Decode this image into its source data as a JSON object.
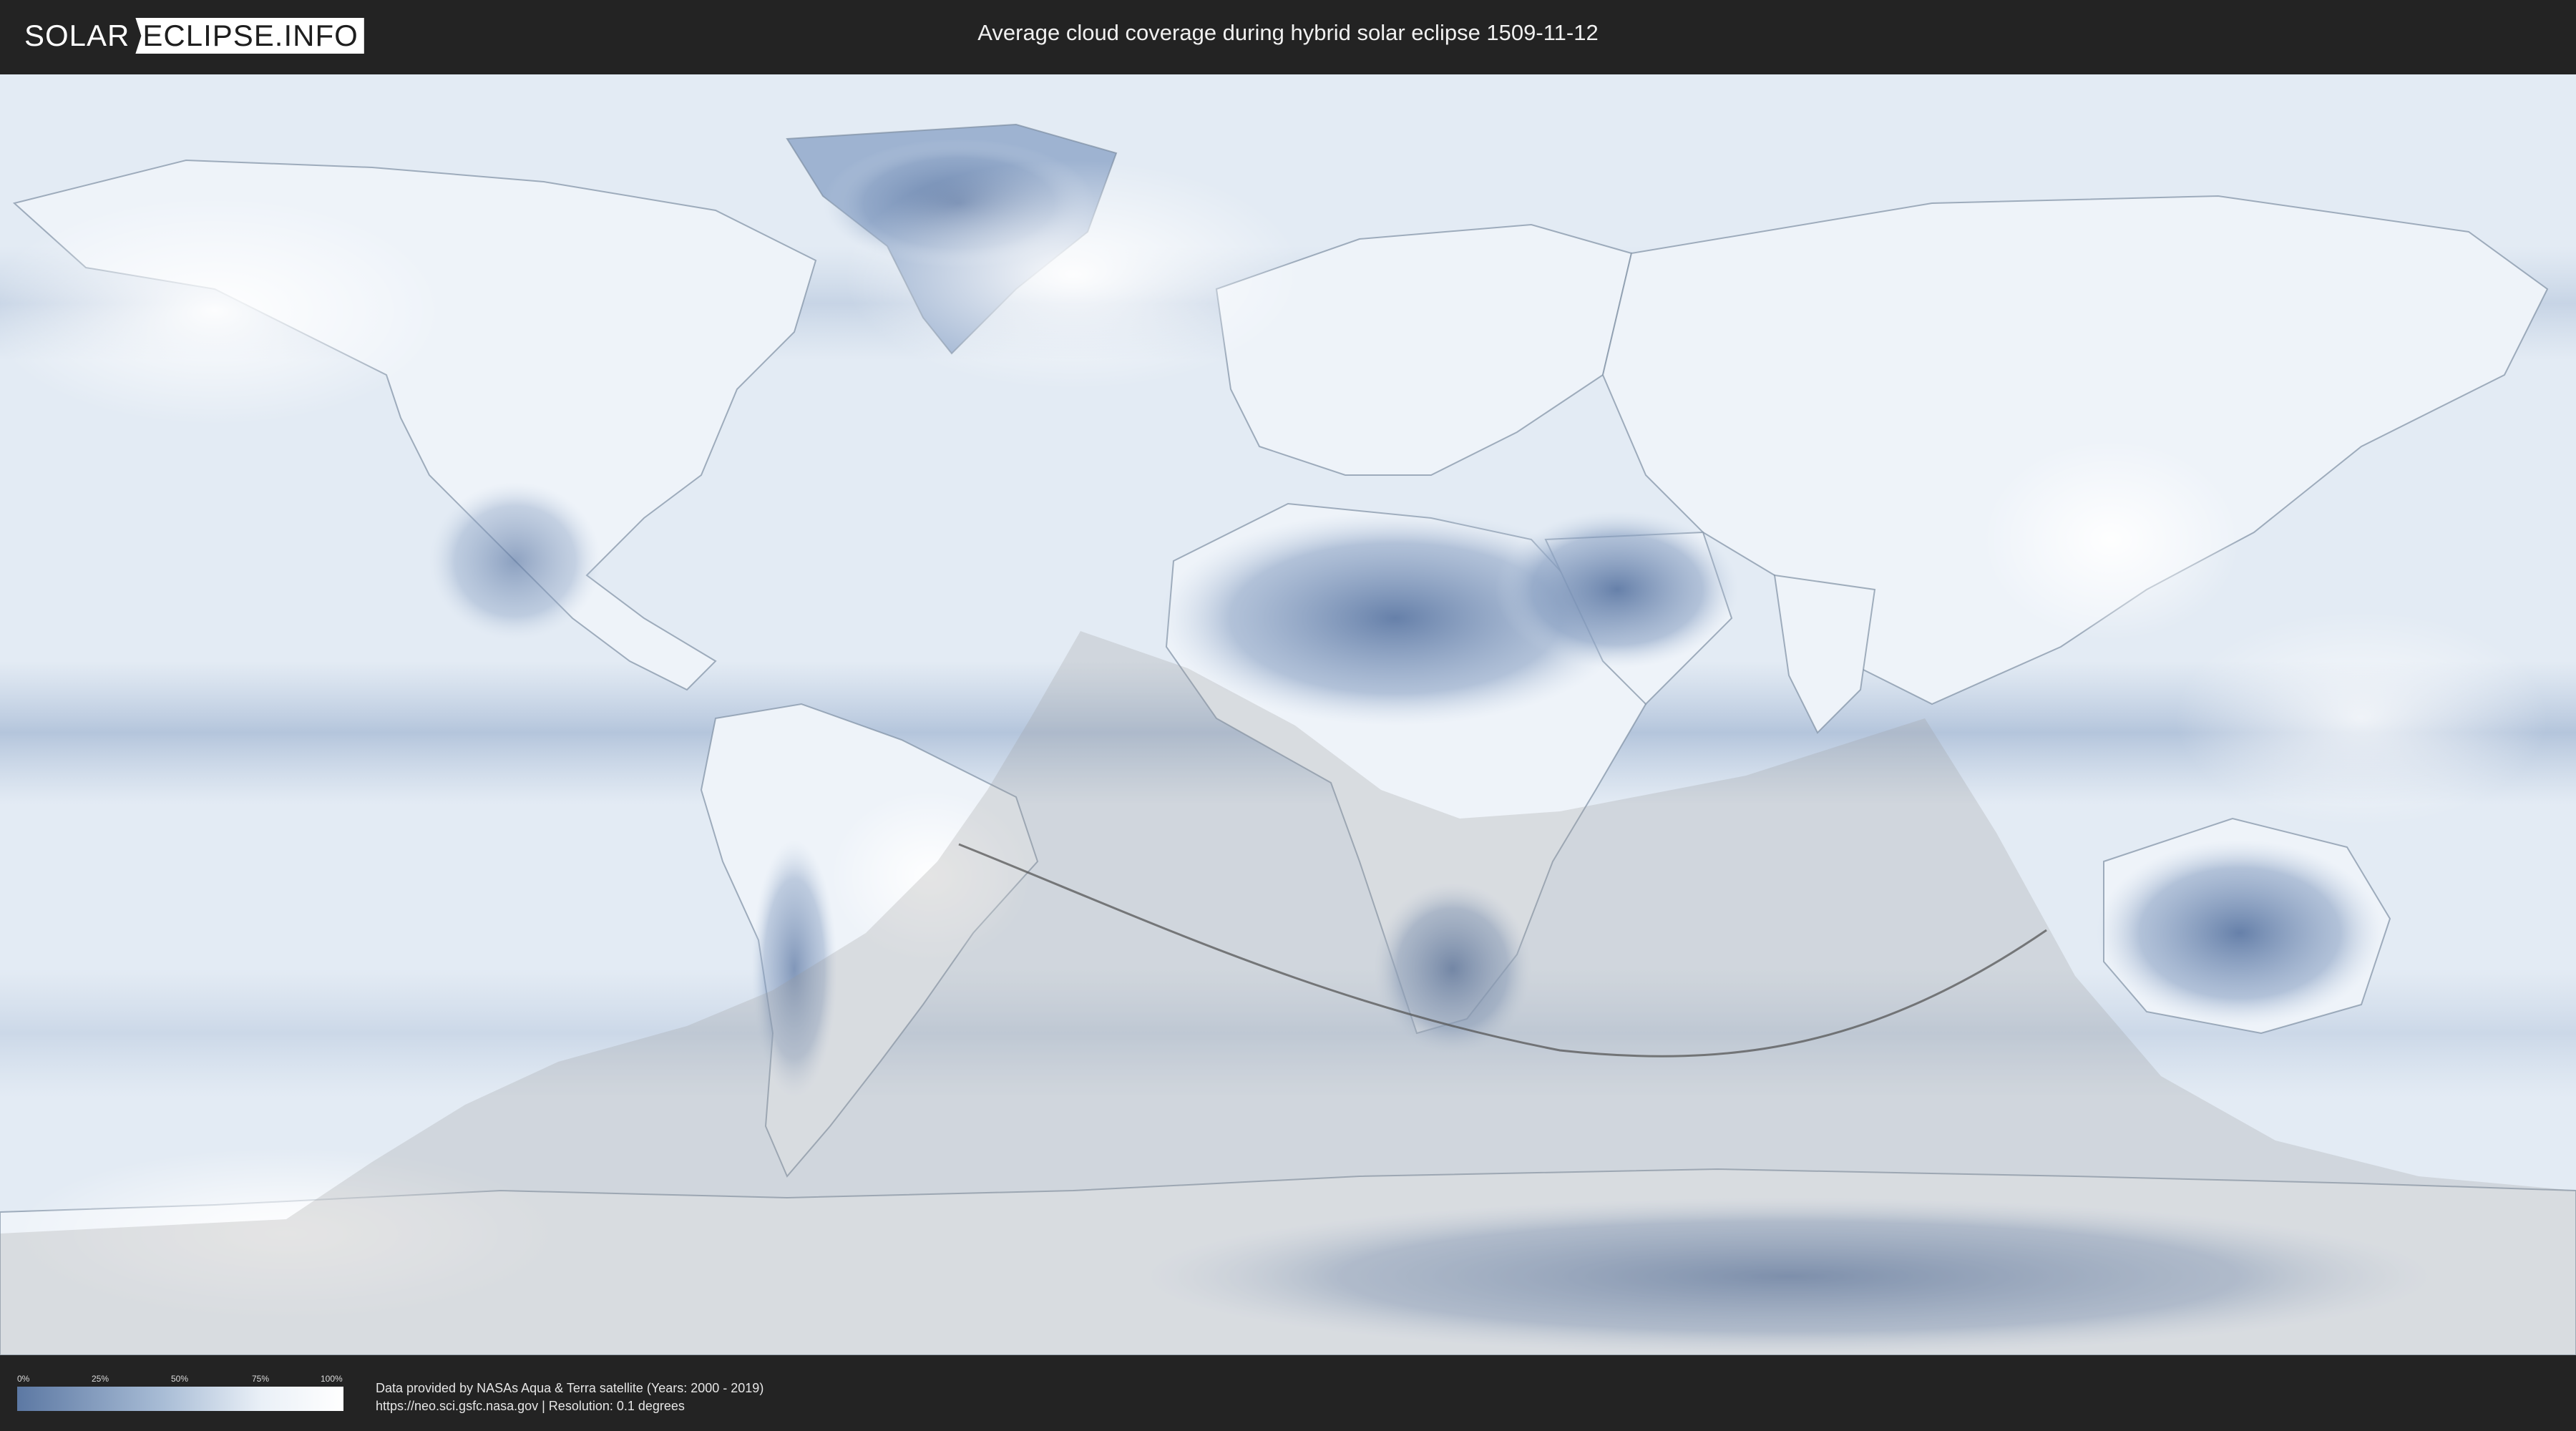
{
  "header": {
    "logo_left": "SOLAR",
    "logo_right": "ECLIPSE.INFO",
    "title": "Average cloud coverage during hybrid solar eclipse 1509-11-12"
  },
  "legend": {
    "ticks": [
      "0%",
      "25%",
      "50%",
      "75%",
      "100%"
    ],
    "gradient_colors": [
      "#5c78a3",
      "#a9bdd6",
      "#eaf0f7",
      "#ffffff"
    ]
  },
  "footer": {
    "source_line": "Data provided by NASAs Aqua & Terra satellite (Years: 2000 - 2019)",
    "url_line": "https://neo.sci.gsfc.nasa.gov | Resolution: 0.1 degrees"
  },
  "map": {
    "ocean_color": "#e7eef6",
    "cloud_color": "#ffffff",
    "clear_sky_color": "#6f88b0",
    "eclipse_shadow_color": "#9a9a9a",
    "central_line_color": "#555555"
  }
}
